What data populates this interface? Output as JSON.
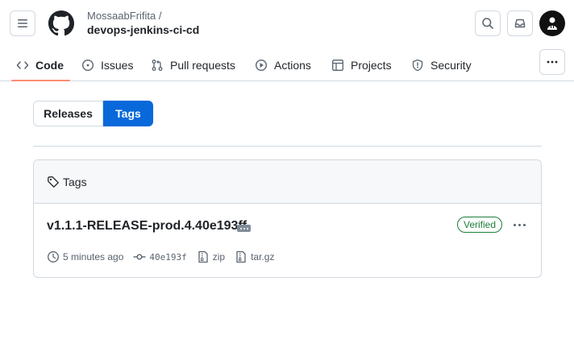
{
  "header": {
    "owner": "MossaabFrifita /",
    "repo": "devops-jenkins-ci-cd"
  },
  "nav": {
    "tabs": [
      {
        "label": "Code",
        "icon": "code-icon",
        "active": true
      },
      {
        "label": "Issues",
        "icon": "issue-icon",
        "active": false
      },
      {
        "label": "Pull requests",
        "icon": "pull-request-icon",
        "active": false
      },
      {
        "label": "Actions",
        "icon": "play-icon",
        "active": false
      },
      {
        "label": "Projects",
        "icon": "table-icon",
        "active": false
      },
      {
        "label": "Security",
        "icon": "shield-icon",
        "active": false
      }
    ]
  },
  "toggle": {
    "releases_label": "Releases",
    "tags_label": "Tags",
    "selected": "Tags"
  },
  "tags_box": {
    "header_label": "Tags",
    "items": [
      {
        "name": "v1.1.1-RELEASE-prod.4.40e193ff",
        "badge": "Verified",
        "time": "5 minutes ago",
        "commit": "40e193f",
        "zip_label": "zip",
        "targz_label": "tar.gz"
      }
    ]
  },
  "colors": {
    "accent": "#0969da",
    "active_tab_underline": "#fd8c73",
    "verified": "#1a7f37",
    "border": "#d1d9e0",
    "muted_text": "#59636e"
  }
}
